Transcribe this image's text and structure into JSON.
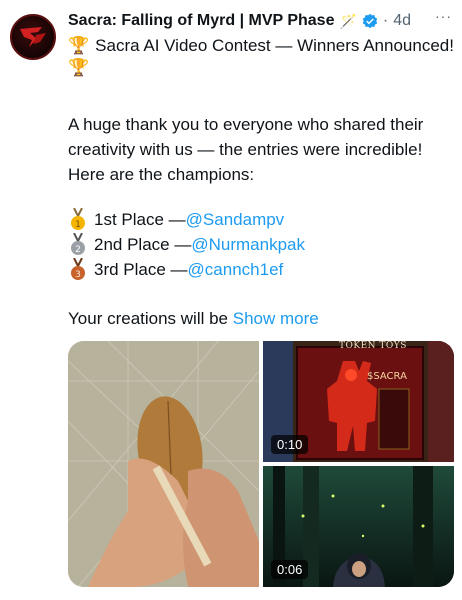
{
  "post": {
    "author": "Sacra: Falling of Myrd | MVP Phase",
    "dot": "·",
    "time": "4d",
    "more": "···",
    "title_emoji": "🏆",
    "title": "Sacra AI Video Contest — Winners Announced!",
    "title_emoji2": "🏆",
    "intro": "A huge thank you to everyone who shared their creativity with us — the entries were incredible! Here are the champions:",
    "winners": [
      {
        "label": "1st Place — ",
        "handle": "@Sandampv",
        "medal_color": "#f4b400"
      },
      {
        "label": "2nd Place — ",
        "handle": "@Nurmankpak",
        "medal_color": "#9aa0a6"
      },
      {
        "label": "3rd Place — ",
        "handle": "@cannch1ef",
        "medal_color": "#c7622b"
      }
    ],
    "closing": "Your creations will be ",
    "show_more": "Show more"
  },
  "media": {
    "tiles": [
      {
        "name": "leaf-drawing-video",
        "duration": ""
      },
      {
        "name": "token-toys-video",
        "duration": "0:10",
        "sign": "TOKEN TOYS",
        "price": "$SACRA"
      },
      {
        "name": "forest-knight-video",
        "duration": "0:06"
      }
    ]
  },
  "colors": {
    "link": "#1d9bf0",
    "verified": "#1d9bf0",
    "muted": "#536471"
  }
}
